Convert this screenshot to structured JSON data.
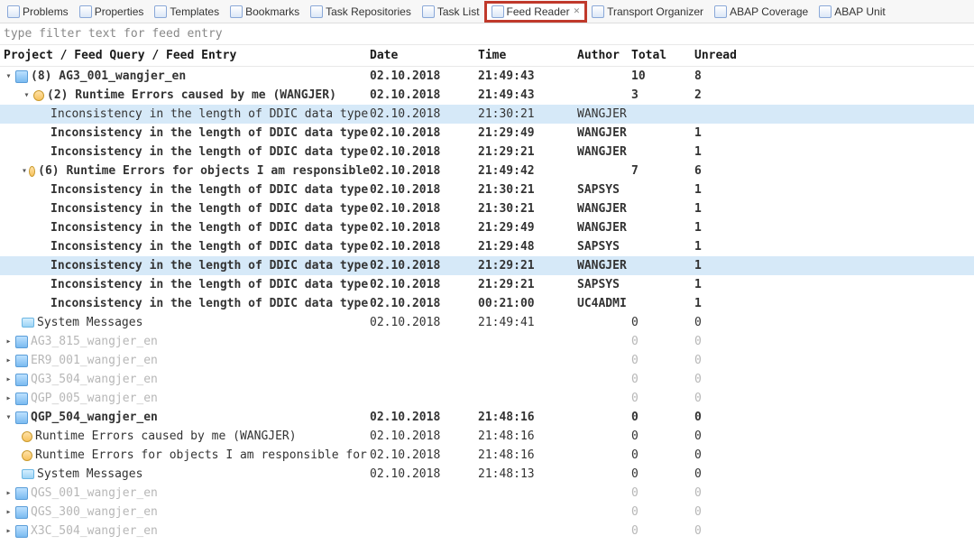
{
  "tabs": [
    {
      "label": "Problems"
    },
    {
      "label": "Properties"
    },
    {
      "label": "Templates"
    },
    {
      "label": "Bookmarks"
    },
    {
      "label": "Task Repositories"
    },
    {
      "label": "Task List"
    },
    {
      "label": "Feed Reader",
      "active": true,
      "highlight": true
    },
    {
      "label": "Transport Organizer"
    },
    {
      "label": "ABAP Coverage"
    },
    {
      "label": "ABAP Unit"
    }
  ],
  "filter_placeholder": "type filter text for feed entry",
  "columns": {
    "proj": "Project / Feed Query / Feed Entry",
    "date": "Date",
    "time": "Time",
    "author": "Author",
    "total": "Total",
    "unread": "Unread"
  },
  "rows": [
    {
      "indent": 0,
      "type": "project",
      "expand": "open",
      "bold": true,
      "label": "(8) AG3_001_wangjer_en",
      "date": "02.10.2018",
      "time": "21:49:43",
      "author": "",
      "total": "10",
      "unread": "8"
    },
    {
      "indent": 1,
      "type": "feedq",
      "expand": "open",
      "bold": true,
      "label": "(2) Runtime Errors caused by me (WANGJER)",
      "date": "02.10.2018",
      "time": "21:49:43",
      "author": "",
      "total": "3",
      "unread": "2"
    },
    {
      "indent": 2,
      "type": "entry",
      "bold": false,
      "sel": true,
      "label": "Inconsistency in the length of DDIC data type",
      "date": "02.10.2018",
      "time": "21:30:21",
      "author": "WANGJER",
      "total": "",
      "unread": ""
    },
    {
      "indent": 2,
      "type": "entry",
      "bold": true,
      "label": "Inconsistency in the length of DDIC data type",
      "date": "02.10.2018",
      "time": "21:29:49",
      "author": "WANGJER",
      "total": "",
      "unread": "1"
    },
    {
      "indent": 2,
      "type": "entry",
      "bold": true,
      "label": "Inconsistency in the length of DDIC data type",
      "date": "02.10.2018",
      "time": "21:29:21",
      "author": "WANGJER",
      "total": "",
      "unread": "1"
    },
    {
      "indent": 1,
      "type": "feedq",
      "expand": "open",
      "bold": true,
      "label": "(6) Runtime Errors for objects I am responsible",
      "date": "02.10.2018",
      "time": "21:49:42",
      "author": "",
      "total": "7",
      "unread": "6"
    },
    {
      "indent": 2,
      "type": "entry",
      "bold": true,
      "label": "Inconsistency in the length of DDIC data type",
      "date": "02.10.2018",
      "time": "21:30:21",
      "author": "SAPSYS",
      "total": "",
      "unread": "1"
    },
    {
      "indent": 2,
      "type": "entry",
      "bold": true,
      "label": "Inconsistency in the length of DDIC data type",
      "date": "02.10.2018",
      "time": "21:30:21",
      "author": "WANGJER",
      "total": "",
      "unread": "1"
    },
    {
      "indent": 2,
      "type": "entry",
      "bold": true,
      "label": "Inconsistency in the length of DDIC data type",
      "date": "02.10.2018",
      "time": "21:29:49",
      "author": "WANGJER",
      "total": "",
      "unread": "1"
    },
    {
      "indent": 2,
      "type": "entry",
      "bold": true,
      "label": "Inconsistency in the length of DDIC data type",
      "date": "02.10.2018",
      "time": "21:29:48",
      "author": "SAPSYS",
      "total": "",
      "unread": "1"
    },
    {
      "indent": 2,
      "type": "entry",
      "bold": true,
      "sel": true,
      "label": "Inconsistency in the length of DDIC data type",
      "date": "02.10.2018",
      "time": "21:29:21",
      "author": "WANGJER",
      "total": "",
      "unread": "1"
    },
    {
      "indent": 2,
      "type": "entry",
      "bold": true,
      "label": "Inconsistency in the length of DDIC data type",
      "date": "02.10.2018",
      "time": "21:29:21",
      "author": "SAPSYS",
      "total": "",
      "unread": "1"
    },
    {
      "indent": 2,
      "type": "entry",
      "bold": true,
      "label": "Inconsistency in the length of DDIC data type",
      "date": "02.10.2018",
      "time": "00:21:00",
      "author": "UC4ADMI",
      "total": "",
      "unread": "1"
    },
    {
      "indent": 1,
      "type": "sysmsg",
      "bold": false,
      "label": "System Messages",
      "date": "02.10.2018",
      "time": "21:49:41",
      "author": "",
      "total": "0",
      "unread": "0"
    },
    {
      "indent": 0,
      "type": "project",
      "expand": "closed",
      "inactive": true,
      "label": "AG3_815_wangjer_en",
      "date": "",
      "time": "",
      "author": "",
      "total": "0",
      "unread": "0"
    },
    {
      "indent": 0,
      "type": "project",
      "expand": "closed",
      "inactive": true,
      "label": "ER9_001_wangjer_en",
      "date": "",
      "time": "",
      "author": "",
      "total": "0",
      "unread": "0"
    },
    {
      "indent": 0,
      "type": "project",
      "expand": "closed",
      "inactive": true,
      "label": "QG3_504_wangjer_en",
      "date": "",
      "time": "",
      "author": "",
      "total": "0",
      "unread": "0"
    },
    {
      "indent": 0,
      "type": "project",
      "expand": "closed",
      "inactive": true,
      "label": "QGP_005_wangjer_en",
      "date": "",
      "time": "",
      "author": "",
      "total": "0",
      "unread": "0"
    },
    {
      "indent": 0,
      "type": "project",
      "expand": "open",
      "bold": true,
      "label": "QGP_504_wangjer_en",
      "date": "02.10.2018",
      "time": "21:48:16",
      "author": "",
      "total": "0",
      "unread": "0"
    },
    {
      "indent": 1,
      "type": "feedq",
      "bold": false,
      "label": "Runtime Errors caused by me (WANGJER)",
      "date": "02.10.2018",
      "time": "21:48:16",
      "author": "",
      "total": "0",
      "unread": "0"
    },
    {
      "indent": 1,
      "type": "feedq",
      "bold": false,
      "label": "Runtime Errors for objects I am responsible for",
      "date": "02.10.2018",
      "time": "21:48:16",
      "author": "",
      "total": "0",
      "unread": "0"
    },
    {
      "indent": 1,
      "type": "sysmsg",
      "bold": false,
      "label": "System Messages",
      "date": "02.10.2018",
      "time": "21:48:13",
      "author": "",
      "total": "0",
      "unread": "0"
    },
    {
      "indent": 0,
      "type": "project",
      "expand": "closed",
      "inactive": true,
      "label": "QGS_001_wangjer_en",
      "date": "",
      "time": "",
      "author": "",
      "total": "0",
      "unread": "0"
    },
    {
      "indent": 0,
      "type": "project",
      "expand": "closed",
      "inactive": true,
      "label": "QGS_300_wangjer_en",
      "date": "",
      "time": "",
      "author": "",
      "total": "0",
      "unread": "0"
    },
    {
      "indent": 0,
      "type": "project",
      "expand": "closed",
      "inactive": true,
      "label": "X3C_504_wangjer_en",
      "date": "",
      "time": "",
      "author": "",
      "total": "0",
      "unread": "0"
    }
  ]
}
